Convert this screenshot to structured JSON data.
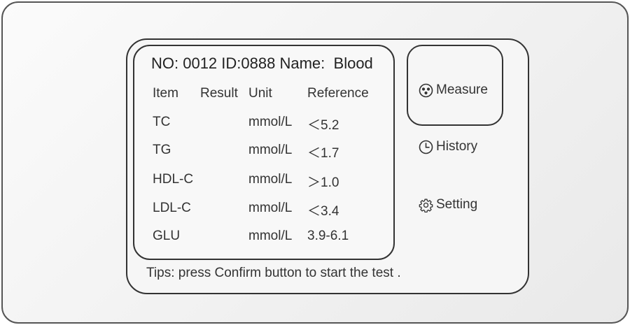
{
  "header": {
    "no_label": "NO: 0012",
    "id_label": "ID:0888",
    "name_label": "Name:",
    "name_value": "Blood"
  },
  "table": {
    "columns": [
      "Item",
      "Result",
      "Unit",
      "Reference"
    ],
    "rows": [
      {
        "item": "TC",
        "result": "",
        "unit": "mmol/L",
        "reference": "＜5.2"
      },
      {
        "item": "TG",
        "result": "",
        "unit": "mmol/L",
        "reference": "＜1.7"
      },
      {
        "item": "HDL-C",
        "result": "",
        "unit": "mmol/L",
        "reference": "＞1.0"
      },
      {
        "item": "LDL-C",
        "result": "",
        "unit": "mmol/L",
        "reference": "＜3.4"
      },
      {
        "item": "GLU",
        "result": "",
        "unit": "mmol/L",
        "reference": "3.9-6.1"
      }
    ]
  },
  "menu": {
    "measure": {
      "label": "Measure",
      "icon": "droplets-icon"
    },
    "history": {
      "label": "History",
      "icon": "clock-icon"
    },
    "setting": {
      "label": "Setting",
      "icon": "gear-icon"
    }
  },
  "tips": "Tips: press Confirm button to start the test ."
}
